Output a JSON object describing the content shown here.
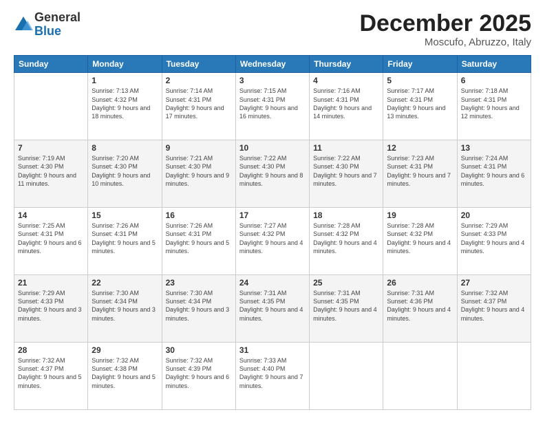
{
  "logo": {
    "general": "General",
    "blue": "Blue"
  },
  "header": {
    "month": "December 2025",
    "location": "Moscufo, Abruzzo, Italy"
  },
  "weekdays": [
    "Sunday",
    "Monday",
    "Tuesday",
    "Wednesday",
    "Thursday",
    "Friday",
    "Saturday"
  ],
  "weeks": [
    [
      {
        "day": "",
        "info": ""
      },
      {
        "day": "1",
        "info": "Sunrise: 7:13 AM\nSunset: 4:32 PM\nDaylight: 9 hours\nand 18 minutes."
      },
      {
        "day": "2",
        "info": "Sunrise: 7:14 AM\nSunset: 4:31 PM\nDaylight: 9 hours\nand 17 minutes."
      },
      {
        "day": "3",
        "info": "Sunrise: 7:15 AM\nSunset: 4:31 PM\nDaylight: 9 hours\nand 16 minutes."
      },
      {
        "day": "4",
        "info": "Sunrise: 7:16 AM\nSunset: 4:31 PM\nDaylight: 9 hours\nand 14 minutes."
      },
      {
        "day": "5",
        "info": "Sunrise: 7:17 AM\nSunset: 4:31 PM\nDaylight: 9 hours\nand 13 minutes."
      },
      {
        "day": "6",
        "info": "Sunrise: 7:18 AM\nSunset: 4:31 PM\nDaylight: 9 hours\nand 12 minutes."
      }
    ],
    [
      {
        "day": "7",
        "info": "Sunrise: 7:19 AM\nSunset: 4:30 PM\nDaylight: 9 hours\nand 11 minutes."
      },
      {
        "day": "8",
        "info": "Sunrise: 7:20 AM\nSunset: 4:30 PM\nDaylight: 9 hours\nand 10 minutes."
      },
      {
        "day": "9",
        "info": "Sunrise: 7:21 AM\nSunset: 4:30 PM\nDaylight: 9 hours\nand 9 minutes."
      },
      {
        "day": "10",
        "info": "Sunrise: 7:22 AM\nSunset: 4:30 PM\nDaylight: 9 hours\nand 8 minutes."
      },
      {
        "day": "11",
        "info": "Sunrise: 7:22 AM\nSunset: 4:30 PM\nDaylight: 9 hours\nand 7 minutes."
      },
      {
        "day": "12",
        "info": "Sunrise: 7:23 AM\nSunset: 4:31 PM\nDaylight: 9 hours\nand 7 minutes."
      },
      {
        "day": "13",
        "info": "Sunrise: 7:24 AM\nSunset: 4:31 PM\nDaylight: 9 hours\nand 6 minutes."
      }
    ],
    [
      {
        "day": "14",
        "info": "Sunrise: 7:25 AM\nSunset: 4:31 PM\nDaylight: 9 hours\nand 6 minutes."
      },
      {
        "day": "15",
        "info": "Sunrise: 7:26 AM\nSunset: 4:31 PM\nDaylight: 9 hours\nand 5 minutes."
      },
      {
        "day": "16",
        "info": "Sunrise: 7:26 AM\nSunset: 4:31 PM\nDaylight: 9 hours\nand 5 minutes."
      },
      {
        "day": "17",
        "info": "Sunrise: 7:27 AM\nSunset: 4:32 PM\nDaylight: 9 hours\nand 4 minutes."
      },
      {
        "day": "18",
        "info": "Sunrise: 7:28 AM\nSunset: 4:32 PM\nDaylight: 9 hours\nand 4 minutes."
      },
      {
        "day": "19",
        "info": "Sunrise: 7:28 AM\nSunset: 4:32 PM\nDaylight: 9 hours\nand 4 minutes."
      },
      {
        "day": "20",
        "info": "Sunrise: 7:29 AM\nSunset: 4:33 PM\nDaylight: 9 hours\nand 4 minutes."
      }
    ],
    [
      {
        "day": "21",
        "info": "Sunrise: 7:29 AM\nSunset: 4:33 PM\nDaylight: 9 hours\nand 3 minutes."
      },
      {
        "day": "22",
        "info": "Sunrise: 7:30 AM\nSunset: 4:34 PM\nDaylight: 9 hours\nand 3 minutes."
      },
      {
        "day": "23",
        "info": "Sunrise: 7:30 AM\nSunset: 4:34 PM\nDaylight: 9 hours\nand 3 minutes."
      },
      {
        "day": "24",
        "info": "Sunrise: 7:31 AM\nSunset: 4:35 PM\nDaylight: 9 hours\nand 4 minutes."
      },
      {
        "day": "25",
        "info": "Sunrise: 7:31 AM\nSunset: 4:35 PM\nDaylight: 9 hours\nand 4 minutes."
      },
      {
        "day": "26",
        "info": "Sunrise: 7:31 AM\nSunset: 4:36 PM\nDaylight: 9 hours\nand 4 minutes."
      },
      {
        "day": "27",
        "info": "Sunrise: 7:32 AM\nSunset: 4:37 PM\nDaylight: 9 hours\nand 4 minutes."
      }
    ],
    [
      {
        "day": "28",
        "info": "Sunrise: 7:32 AM\nSunset: 4:37 PM\nDaylight: 9 hours\nand 5 minutes."
      },
      {
        "day": "29",
        "info": "Sunrise: 7:32 AM\nSunset: 4:38 PM\nDaylight: 9 hours\nand 5 minutes."
      },
      {
        "day": "30",
        "info": "Sunrise: 7:32 AM\nSunset: 4:39 PM\nDaylight: 9 hours\nand 6 minutes."
      },
      {
        "day": "31",
        "info": "Sunrise: 7:33 AM\nSunset: 4:40 PM\nDaylight: 9 hours\nand 7 minutes."
      },
      {
        "day": "",
        "info": ""
      },
      {
        "day": "",
        "info": ""
      },
      {
        "day": "",
        "info": ""
      }
    ]
  ]
}
